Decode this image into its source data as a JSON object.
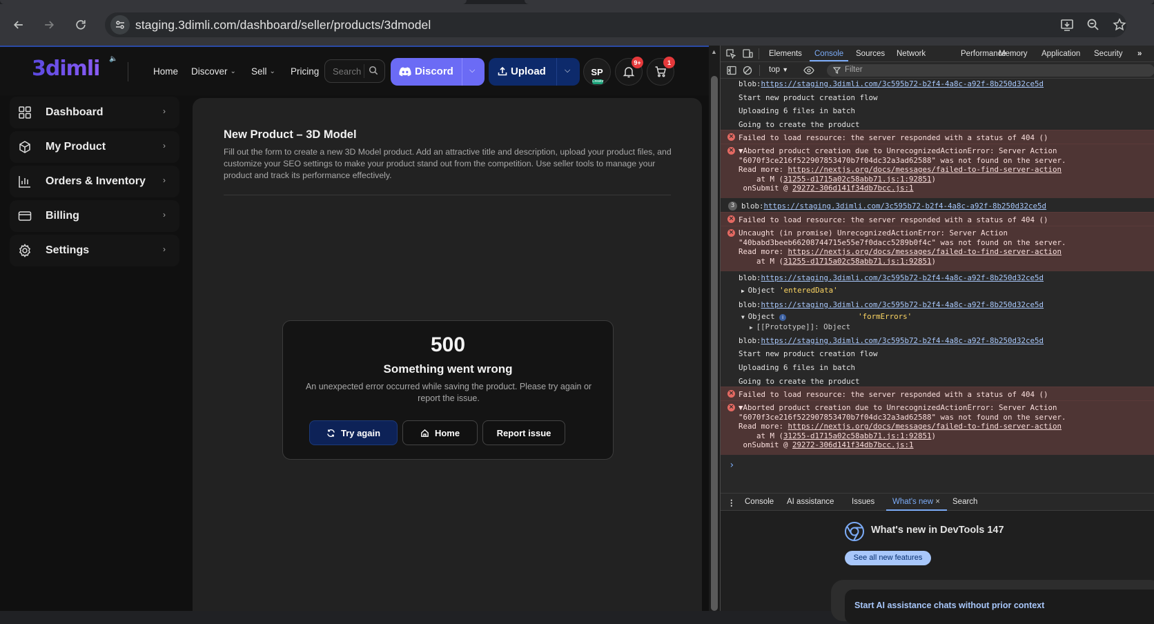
{
  "browser": {
    "url": "staging.3dimli.com/dashboard/seller/products/3dmodel"
  },
  "site": {
    "logo": "3dimli",
    "nav": [
      {
        "label": "Home"
      },
      {
        "label": "Discover"
      },
      {
        "label": "Sell"
      },
      {
        "label": "Pricing"
      }
    ],
    "search_placeholder": "Search",
    "discord_label": "Discord",
    "upload_label": "Upload",
    "avatar_initials": "SP",
    "avatar_badge": "Creator",
    "notifications_badge": "9+",
    "cart_badge": "1",
    "colors": {
      "discord": "#6b6bf5",
      "upload": "#0d2a6b",
      "badge": "#e5393b"
    }
  },
  "sidebar": {
    "items": [
      {
        "label": "Dashboard",
        "icon": "grid-icon"
      },
      {
        "label": "My Product",
        "icon": "box-icon"
      },
      {
        "label": "Orders & Inventory",
        "icon": "bar-chart-icon"
      },
      {
        "label": "Billing",
        "icon": "credit-card-icon"
      },
      {
        "label": "Settings",
        "icon": "gear-icon"
      }
    ]
  },
  "main": {
    "title": "New Product – 3D Model",
    "description": "Fill out the form to create a new 3D Model product. Add an attractive title and description, upload your product files, and customize your SEO settings to make your product stand out from the competition. Use seller tools to manage your product and track its performance effectively.",
    "error": {
      "code": "500",
      "title": "Something went wrong",
      "message": "An unexpected error occurred while saving the product. Please try again or report the issue.",
      "try_again": "Try again",
      "home": "Home",
      "report": "Report issue"
    }
  },
  "devtools": {
    "tabs": [
      "Elements",
      "Console",
      "Sources",
      "Network",
      "Performance",
      "Memory",
      "Application",
      "Security"
    ],
    "context": "top",
    "filter_placeholder": "Filter",
    "console": {
      "blob_url": "https://staging.3dimli.com/3c595b72-b2f4-4a8c-a92f-8b250d32ce5d",
      "blob_prefix": "blob:",
      "start_flow": "Start new product creation flow",
      "uploading": "Uploading 6 files in batch",
      "going": "Going to create the product",
      "failed_404": "Failed to load resource: the server responded with a status of 404 ()",
      "aborted_1": "▼Aborted product creation due to UnrecognizedActionError: Server Action",
      "aborted_2": "\"6070f3ce216f522907853470b7f04dc32a3ad62588\" was not found on the server.",
      "read_more": "Read more: ",
      "read_more_url": "https://nextjs.org/docs/messages/failed-to-find-server-action",
      "at_m_prefix": "    at M (",
      "at_m_link": "31255-d1715a02c58abb71.js:1:92851",
      "at_m_suffix": ")",
      "onsubmit_prefix": "onSubmit @ ",
      "onsubmit_link": "29272-306d141f34db7bcc.js:1",
      "repeat_count": "3",
      "uncaught_1": "Uncaught (in promise) UnrecognizedActionError: Server Action",
      "uncaught_2": "\"40babd3beeb66208744715e55e7f0dacc5289b0f4c\" was not found on the server.",
      "object_label": "Object ",
      "entered_data": "'enteredData'",
      "form_errors": "'formErrors'",
      "prototype": "[[Prototype]]: Object",
      "prompt": "›"
    },
    "drawer_tabs": [
      "Console",
      "AI assistance",
      "Issues",
      "What's new",
      "Search"
    ],
    "whatsnew_title": "What's new in DevTools 147",
    "whatsnew_button": "See all new features",
    "whatsnew_card_title": "Start AI assistance chats without prior context"
  }
}
